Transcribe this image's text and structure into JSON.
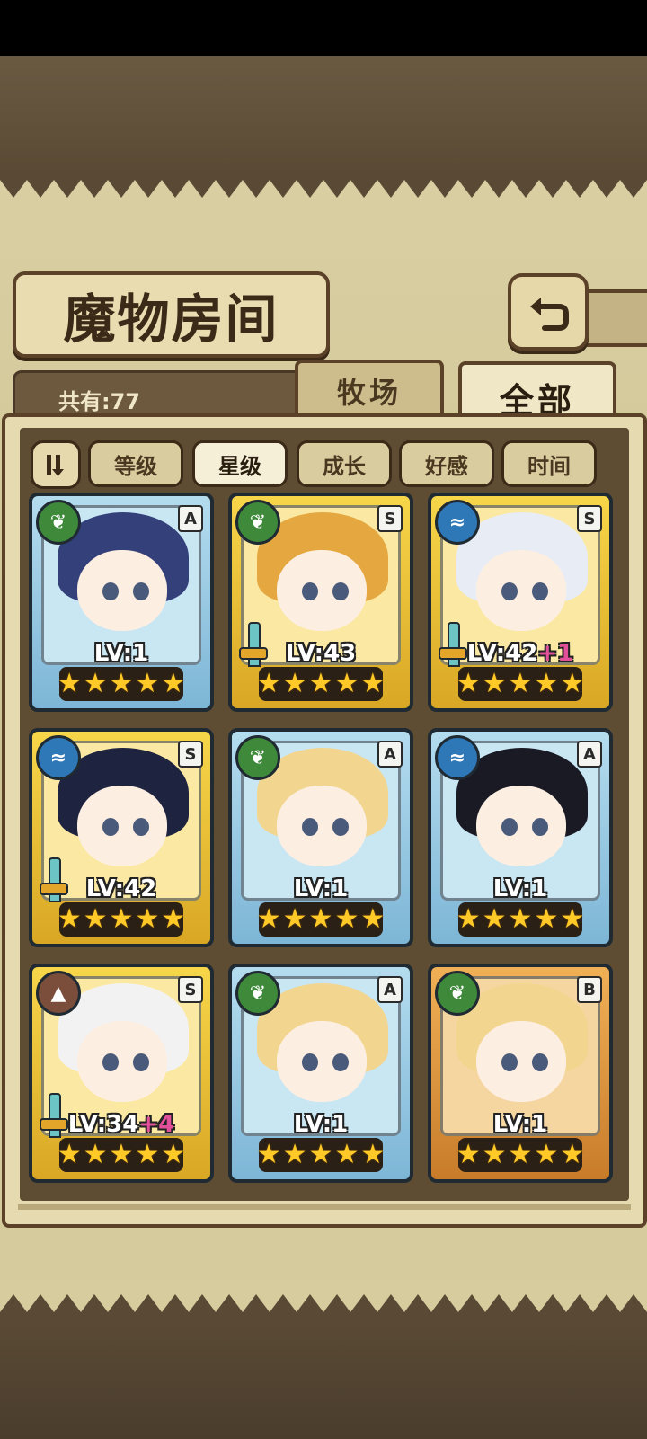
{
  "header": {
    "title": "魔物房间",
    "back_icon": "back-arrow-icon"
  },
  "summary": {
    "count_label": "共有:77"
  },
  "tabs": [
    {
      "label": "牧场",
      "selected": false
    },
    {
      "label": "全部",
      "selected": true
    }
  ],
  "sort": {
    "toggle_icon": "sort-order-icon",
    "buttons": [
      {
        "label": "等级",
        "active": false
      },
      {
        "label": "星级",
        "active": true
      },
      {
        "label": "成长",
        "active": false
      },
      {
        "label": "好感",
        "active": false
      },
      {
        "label": "时间",
        "active": false
      }
    ]
  },
  "monsters": [
    {
      "level": "LV:1",
      "bonus": "",
      "rank": "A",
      "element": "leaf",
      "frame": "blue",
      "stars": 5,
      "weapon": false,
      "hair": "#33407a"
    },
    {
      "level": "LV:43",
      "bonus": "",
      "rank": "S",
      "element": "leaf",
      "frame": "gold",
      "stars": 5,
      "weapon": true,
      "hair": "#e5a840"
    },
    {
      "level": "LV:42",
      "bonus": "+1",
      "rank": "S",
      "element": "water",
      "frame": "gold",
      "stars": 5,
      "weapon": true,
      "hair": "#e8ecf4"
    },
    {
      "level": "LV:42",
      "bonus": "",
      "rank": "S",
      "element": "water",
      "frame": "gold",
      "stars": 5,
      "weapon": true,
      "hair": "#1e2340"
    },
    {
      "level": "LV:1",
      "bonus": "",
      "rank": "A",
      "element": "leaf",
      "frame": "blue",
      "stars": 5,
      "weapon": false,
      "hair": "#f2d690"
    },
    {
      "level": "LV:1",
      "bonus": "",
      "rank": "A",
      "element": "water",
      "frame": "blue",
      "stars": 5,
      "weapon": false,
      "hair": "#1a1a24"
    },
    {
      "level": "LV:34",
      "bonus": "+4",
      "rank": "S",
      "element": "earth",
      "frame": "gold",
      "stars": 5,
      "weapon": true,
      "hair": "#f2f2f2"
    },
    {
      "level": "LV:1",
      "bonus": "",
      "rank": "A",
      "element": "leaf",
      "frame": "blue",
      "stars": 5,
      "weapon": false,
      "hair": "#f2d690"
    },
    {
      "level": "LV:1",
      "bonus": "",
      "rank": "B",
      "element": "leaf",
      "frame": "orange",
      "stars": 5,
      "weapon": false,
      "hair": "#f2d690"
    }
  ],
  "colors": {
    "leaf": "#3f8a3a",
    "water": "#2f78b8",
    "earth": "#7a4e3a"
  }
}
